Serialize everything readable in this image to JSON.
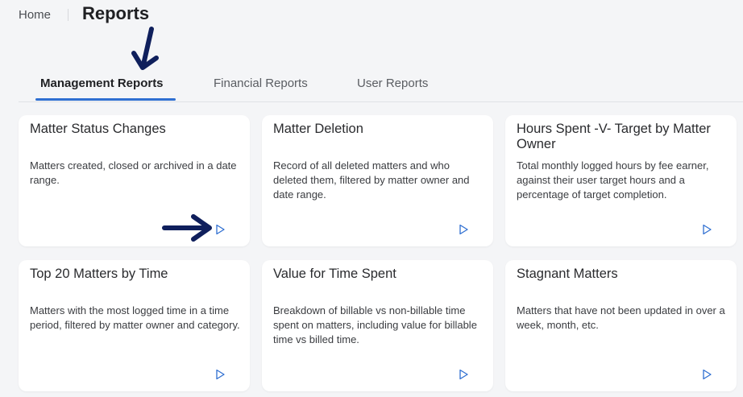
{
  "breadcrumb": {
    "home": "Home",
    "current": "Reports"
  },
  "tabs": [
    {
      "label": "Management Reports",
      "active": true
    },
    {
      "label": "Financial Reports",
      "active": false
    },
    {
      "label": "User Reports",
      "active": false
    }
  ],
  "cards": [
    {
      "title": "Matter Status Changes",
      "description": "Matters created, closed or archived in a date range."
    },
    {
      "title": "Matter Deletion",
      "description": "Record of all deleted matters and who deleted them, filtered by matter owner and date range."
    },
    {
      "title": "Hours Spent -V- Target by Matter Owner",
      "description": "Total monthly logged hours by fee earner, against their user target hours and a percentage of target completion."
    },
    {
      "title": "Top 20 Matters by Time",
      "description": "Matters with the most logged time in a time period, filtered by matter owner and category."
    },
    {
      "title": "Value for Time Spent",
      "description": "Breakdown of billable vs non-billable time spent on matters, including value for billable time vs billed time."
    },
    {
      "title": "Stagnant Matters",
      "description": "Matters that have not been updated in over a week, month, etc."
    }
  ],
  "icons": {
    "run": "play-outline-icon",
    "annotation": "arrow-icon"
  },
  "colors": {
    "accent": "#2f6fd1",
    "annotation": "#0f1f5c",
    "background": "#f4f5f7",
    "card": "#ffffff"
  }
}
